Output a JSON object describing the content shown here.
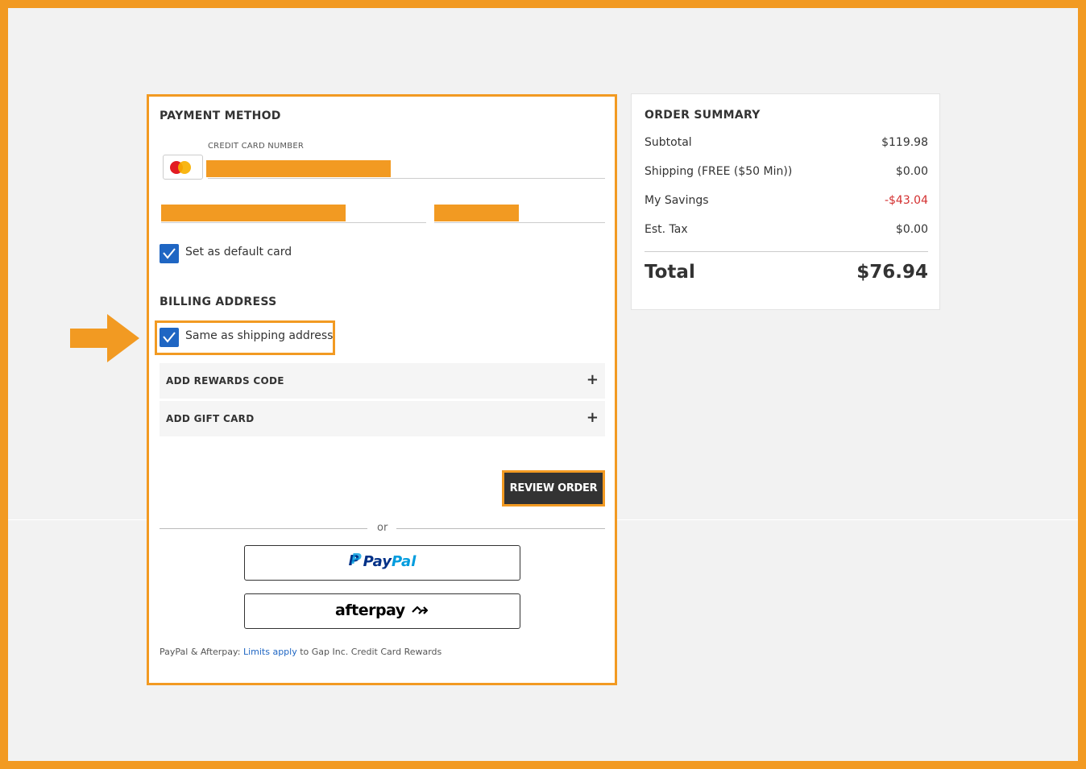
{
  "payment": {
    "title": "PAYMENT METHOD",
    "card_number_label": "CREDIT CARD NUMBER",
    "card_brand_icon": "mastercard-icon",
    "default_card_label": "Set as default card",
    "default_card_checked": true
  },
  "billing": {
    "title": "BILLING ADDRESS",
    "same_as_shipping_label": "Same as shipping address",
    "same_as_shipping_checked": true
  },
  "accordions": [
    {
      "label": "ADD REWARDS CODE",
      "icon": "+"
    },
    {
      "label": "ADD GIFT CARD",
      "icon": "+"
    }
  ],
  "review_button": "REVIEW ORDER",
  "or_text": "or",
  "paypal": {
    "pay": "Pay",
    "pal": "Pal",
    "icon": "P"
  },
  "afterpay": {
    "label": "afterpay"
  },
  "footnote": {
    "prefix": "PayPal & Afterpay: ",
    "link": "Limits apply",
    "suffix": " to Gap Inc. Credit Card Rewards"
  },
  "summary": {
    "title": "ORDER SUMMARY",
    "rows": [
      {
        "label": "Subtotal",
        "value": "$119.98"
      },
      {
        "label": "Shipping (FREE ($50 Min))",
        "value": "$0.00"
      },
      {
        "label": "My Savings",
        "value": "-$43.04"
      },
      {
        "label": "Est. Tax",
        "value": "$0.00"
      }
    ],
    "total_label": "Total",
    "total_value": "$76.94"
  },
  "colors": {
    "accent_orange": "#f29a22",
    "checkbox_blue": "#1f66c3",
    "savings_red": "#d32f2f",
    "button_dark": "#333333"
  }
}
